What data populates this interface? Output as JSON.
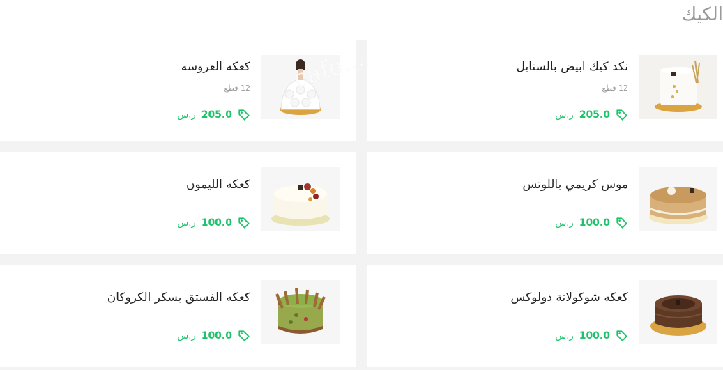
{
  "section": {
    "title": "الكيك"
  },
  "watermark": "cafe...",
  "colors": {
    "price": "#1ec26b",
    "background": "#f3f3f3",
    "card": "#ffffff"
  },
  "items": [
    {
      "name": "نكد كيك ابيض بالسنابل",
      "qty": "12 قطع",
      "price": "205.0",
      "currency": "ر.س",
      "icon": "price-tag-icon"
    },
    {
      "name": "كعكه العروسه",
      "qty": "12 قطع",
      "price": "205.0",
      "currency": "ر.س",
      "icon": "price-tag-icon"
    },
    {
      "name": "موس كريمي باللوتس",
      "price": "100.0",
      "currency": "ر.س",
      "icon": "price-tag-icon"
    },
    {
      "name": "كعكه الليمون",
      "price": "100.0",
      "currency": "ر.س",
      "icon": "price-tag-icon"
    },
    {
      "name": "كعكه شوكولاتة دولوكس",
      "price": "100.0",
      "currency": "ر.س",
      "icon": "price-tag-icon"
    },
    {
      "name": "كعكه الفستق بسكر الكروكان",
      "price": "100.0",
      "currency": "ر.س",
      "icon": "price-tag-icon"
    }
  ]
}
